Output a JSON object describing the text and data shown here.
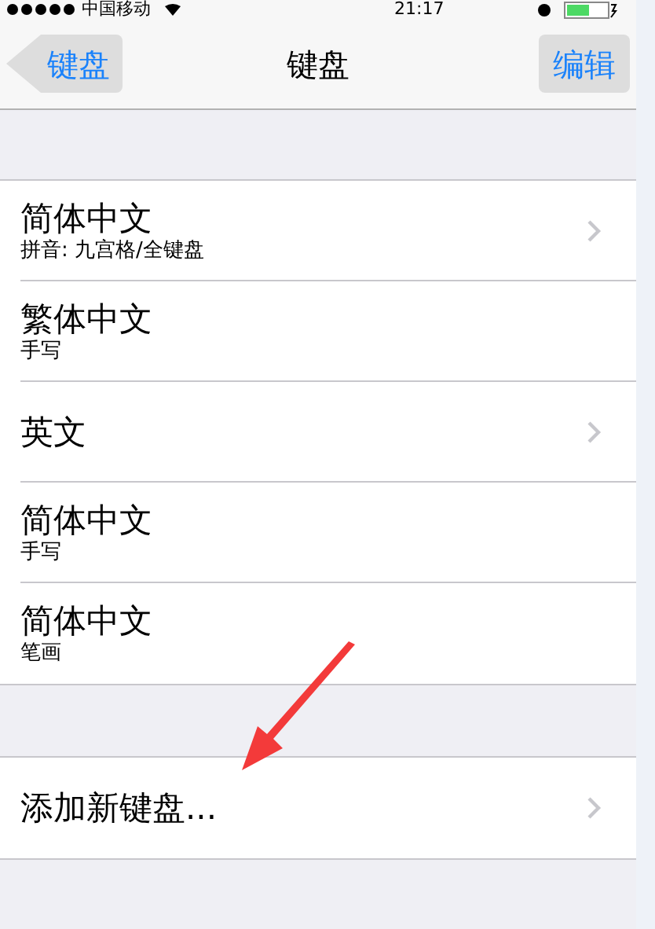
{
  "status_bar": {
    "carrier": "中国移动",
    "time": "21:17"
  },
  "nav_bar": {
    "back": "键盘",
    "title": "键盘",
    "edit": "编辑"
  },
  "keyboards": [
    {
      "title": "简体中文",
      "subtitle": "拼音: 九宫格/全键盘",
      "chevron": true
    },
    {
      "title": "繁体中文",
      "subtitle": "手写",
      "chevron": false
    },
    {
      "title": "英文",
      "chevron": true
    },
    {
      "title": "简体中文",
      "subtitle": "手写",
      "chevron": false
    },
    {
      "title": "简体中文",
      "subtitle": "笔画",
      "chevron": false
    }
  ],
  "add_row": {
    "title": "添加新键盘...",
    "chevron": true
  }
}
